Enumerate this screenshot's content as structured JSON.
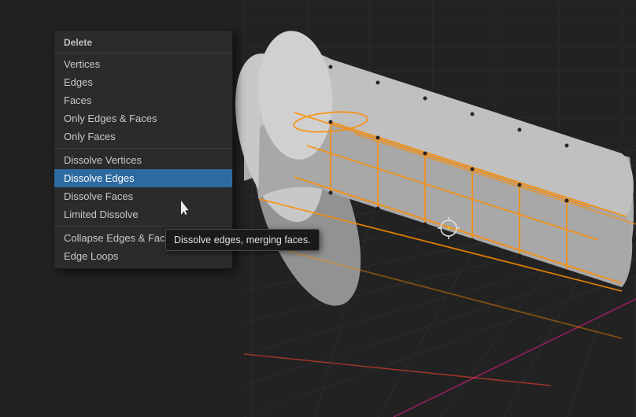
{
  "menu": {
    "title": "Delete",
    "items": [
      {
        "id": "vertices",
        "label": "Vertices",
        "active": false,
        "separator_after": false
      },
      {
        "id": "edges",
        "label": "Edges",
        "active": false,
        "separator_after": false
      },
      {
        "id": "faces",
        "label": "Faces",
        "active": false,
        "separator_after": false
      },
      {
        "id": "only-edges-faces",
        "label": "Only Edges & Faces",
        "active": false,
        "separator_after": false
      },
      {
        "id": "only-faces",
        "label": "Only Faces",
        "active": false,
        "separator_after": true
      },
      {
        "id": "dissolve-vertices",
        "label": "Dissolve Vertices",
        "active": false,
        "separator_after": false
      },
      {
        "id": "dissolve-edges",
        "label": "Dissolve Edges",
        "active": true,
        "separator_after": false
      },
      {
        "id": "dissolve-faces",
        "label": "Dissolve Faces",
        "active": false,
        "separator_after": false
      },
      {
        "id": "limited-dissolve",
        "label": "Limited Dissolve",
        "active": false,
        "separator_after": true
      },
      {
        "id": "collapse-edges-faces",
        "label": "Collapse Edges & Faces",
        "active": false,
        "separator_after": false
      },
      {
        "id": "edge-loops",
        "label": "Edge Loops",
        "active": false,
        "separator_after": false
      }
    ]
  },
  "tooltip": {
    "text": "Dissolve edges, merging faces."
  },
  "viewport": {
    "background_color": "#2a2a2a"
  }
}
